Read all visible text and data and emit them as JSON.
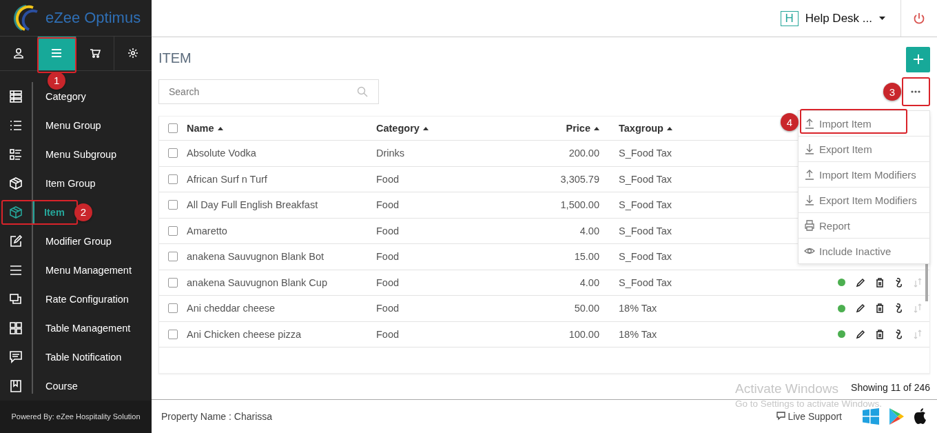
{
  "logo": {
    "text": "eZee Optimus"
  },
  "sidebar": {
    "tabs": [
      {
        "selected": false
      },
      {
        "selected": true,
        "callout": "1"
      },
      {
        "selected": false
      },
      {
        "selected": false
      }
    ],
    "items": [
      {
        "label": "Category",
        "selected": false
      },
      {
        "label": "Menu Group",
        "selected": false
      },
      {
        "label": "Menu Subgroup",
        "selected": false
      },
      {
        "label": "Item Group",
        "selected": false
      },
      {
        "label": "Item",
        "selected": true,
        "callout": "2"
      },
      {
        "label": "Modifier Group",
        "selected": false
      },
      {
        "label": "Menu Management",
        "selected": false
      },
      {
        "label": "Rate Configuration",
        "selected": false
      },
      {
        "label": "Table Management",
        "selected": false
      },
      {
        "label": "Table Notification",
        "selected": false
      },
      {
        "label": "Course",
        "selected": false
      }
    ],
    "footer": "Powered By: eZee Hospitality Solution"
  },
  "topbar": {
    "property_initial": "H",
    "property_name": "Help Desk ..."
  },
  "page": {
    "title": "ITEM",
    "search": {
      "placeholder": "Search"
    },
    "more_callout": "3"
  },
  "table": {
    "columns": [
      "Name",
      "Category",
      "Price",
      "Taxgroup"
    ],
    "all_checked": false,
    "rows": [
      {
        "name": "Absolute Vodka",
        "category": "Drinks",
        "price": "200.00",
        "taxgroup": "S_Food Tax",
        "checked": false
      },
      {
        "name": "African Surf n Turf",
        "category": "Food",
        "price": "3,305.79",
        "taxgroup": "S_Food Tax",
        "checked": false
      },
      {
        "name": "All Day Full English Breakfast",
        "category": "Food",
        "price": "1,500.00",
        "taxgroup": "S_Food Tax",
        "checked": false
      },
      {
        "name": "Amaretto",
        "category": "Food",
        "price": "4.00",
        "taxgroup": "S_Food Tax",
        "checked": false
      },
      {
        "name": "anakena Sauvugnon Blank Bot",
        "category": "Food",
        "price": "15.00",
        "taxgroup": "S_Food Tax",
        "checked": false
      },
      {
        "name": "anakena Sauvugnon Blank Cup",
        "category": "Food",
        "price": "4.00",
        "taxgroup": "S_Food Tax",
        "active": true,
        "checked": false
      },
      {
        "name": "Ani cheddar cheese",
        "category": "Food",
        "price": "50.00",
        "taxgroup": "18% Tax",
        "active": true,
        "checked": false
      },
      {
        "name": "Ani Chicken cheese pizza",
        "category": "Food",
        "price": "100.00",
        "taxgroup": "18% Tax",
        "active": true,
        "checked": false
      }
    ]
  },
  "menu": [
    {
      "label": "Import Item",
      "callout": "4"
    },
    {
      "label": "Export Item"
    },
    {
      "label": "Import Item Modifiers"
    },
    {
      "label": "Export Item Modifiers"
    },
    {
      "label": "Report"
    },
    {
      "label": "Include Inactive"
    }
  ],
  "showing": "Showing 11 of 246",
  "footer": {
    "property": "Property Name : Charissa",
    "live_support": "Live Support"
  },
  "os_notice": {
    "title": "Activate Windows",
    "text": "Go to Settings to activate Windows."
  }
}
